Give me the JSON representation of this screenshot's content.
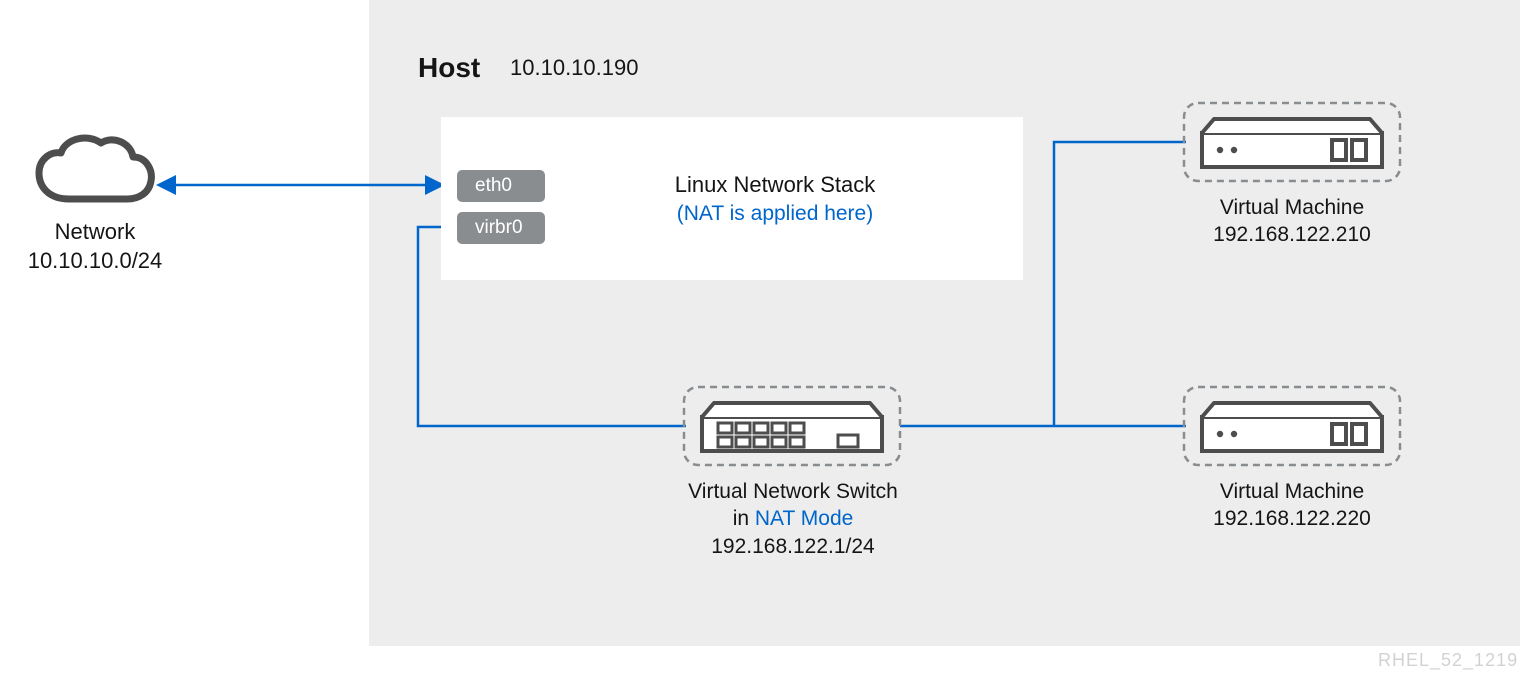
{
  "watermark": "RHEL_52_1219",
  "network": {
    "label": "Network",
    "cidr": "10.10.10.0/24"
  },
  "host": {
    "title": "Host",
    "ip": "10.10.10.190",
    "ifaces": {
      "eth0": "eth0",
      "virbr0": "virbr0"
    },
    "stack": {
      "title": "Linux Network Stack",
      "subtitle": "(NAT is applied here)"
    }
  },
  "vswitch": {
    "line1": "Virtual Network Switch",
    "line2_prefix": "in ",
    "line2_mode": "NAT Mode",
    "cidr": "192.168.122.1/24"
  },
  "vm1": {
    "label": "Virtual Machine",
    "ip": "192.168.122.210"
  },
  "vm2": {
    "label": "Virtual Machine",
    "ip": "192.168.122.220"
  }
}
